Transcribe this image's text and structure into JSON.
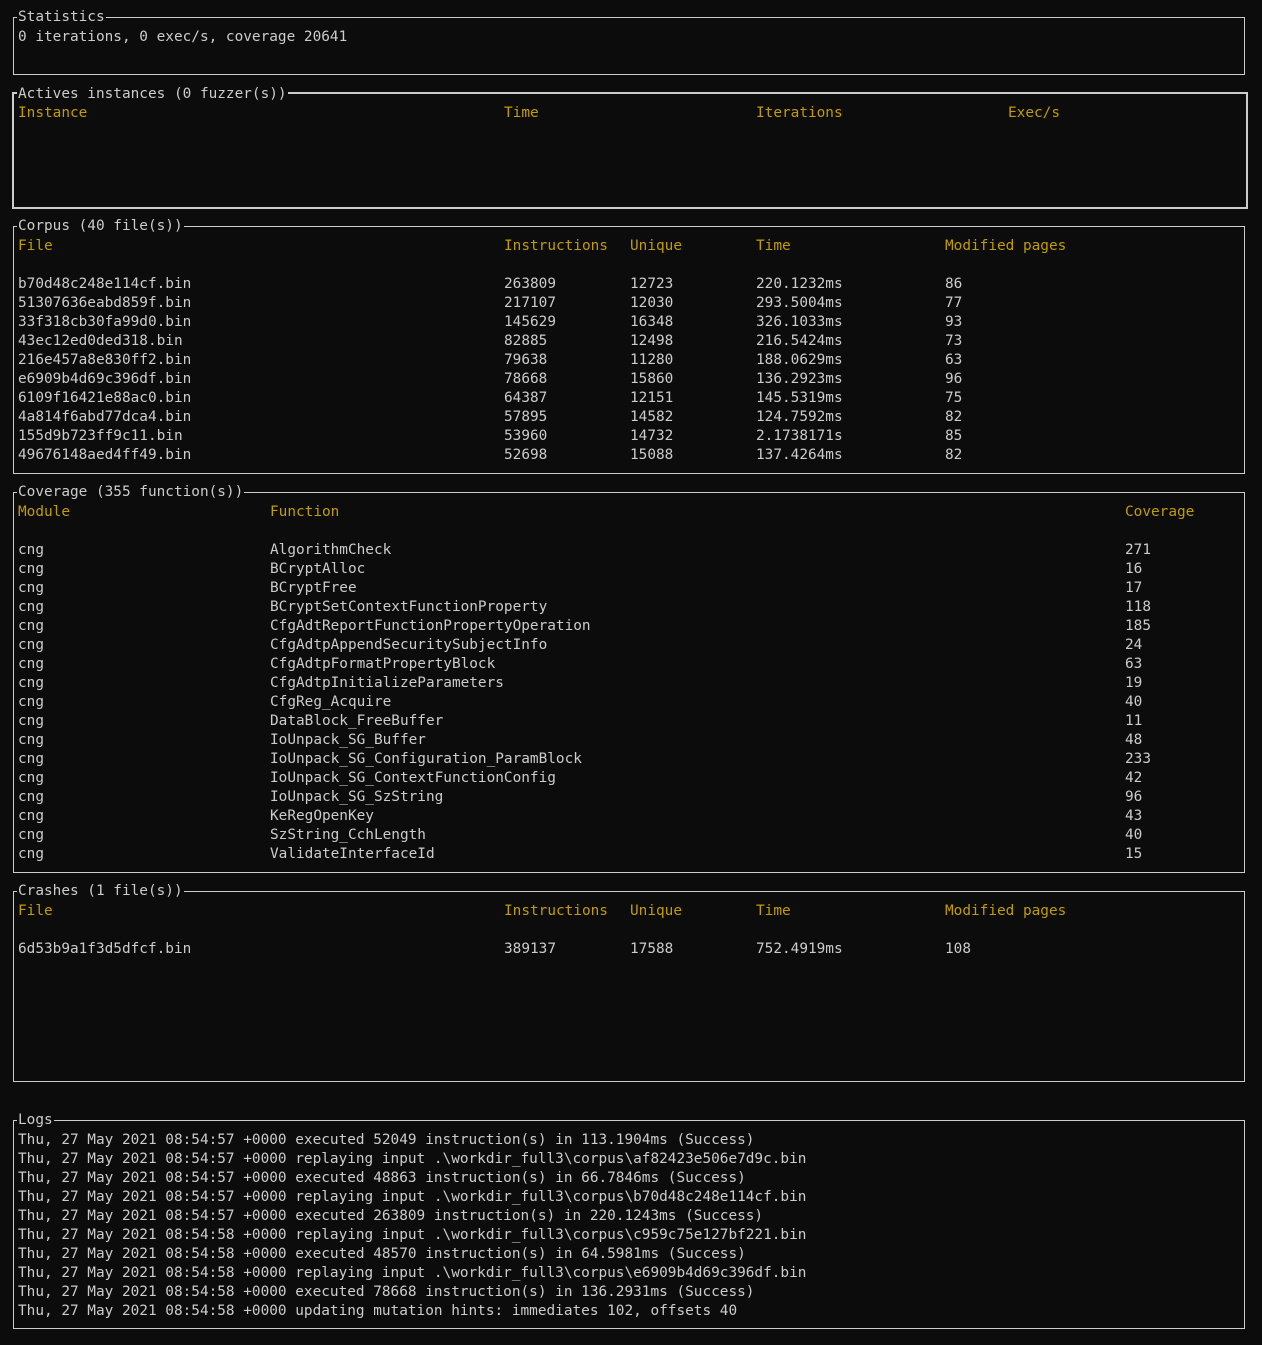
{
  "statistics": {
    "title": "Statistics",
    "text": "0 iterations, 0 exec/s, coverage 20641"
  },
  "actives": {
    "title": "Actives instances (0 fuzzer(s))",
    "headers": [
      "Instance",
      "Time",
      "Iterations",
      "Exec/s"
    ]
  },
  "corpus": {
    "title": "Corpus (40 file(s))",
    "headers": [
      "File",
      "Instructions",
      "Unique",
      "Time",
      "Modified pages"
    ],
    "rows": [
      [
        "b70d48c248e114cf.bin",
        "263809",
        "12723",
        "220.1232ms",
        "86"
      ],
      [
        "51307636eabd859f.bin",
        "217107",
        "12030",
        "293.5004ms",
        "77"
      ],
      [
        "33f318cb30fa99d0.bin",
        "145629",
        "16348",
        "326.1033ms",
        "93"
      ],
      [
        "43ec12ed0ded318.bin",
        "82885",
        "12498",
        "216.5424ms",
        "73"
      ],
      [
        "216e457a8e830ff2.bin",
        "79638",
        "11280",
        "188.0629ms",
        "63"
      ],
      [
        "e6909b4d69c396df.bin",
        "78668",
        "15860",
        "136.2923ms",
        "96"
      ],
      [
        "6109f16421e88ac0.bin",
        "64387",
        "12151",
        "145.5319ms",
        "75"
      ],
      [
        "4a814f6abd77dca4.bin",
        "57895",
        "14582",
        "124.7592ms",
        "82"
      ],
      [
        "155d9b723ff9c11.bin",
        "53960",
        "14732",
        "2.1738171s",
        "85"
      ],
      [
        "49676148aed4ff49.bin",
        "52698",
        "15088",
        "137.4264ms",
        "82"
      ]
    ]
  },
  "coverage": {
    "title": "Coverage (355 function(s))",
    "headers": [
      "Module",
      "Function",
      "Coverage"
    ],
    "rows": [
      [
        "cng",
        "AlgorithmCheck",
        "271"
      ],
      [
        "cng",
        "BCryptAlloc",
        "16"
      ],
      [
        "cng",
        "BCryptFree",
        "17"
      ],
      [
        "cng",
        "BCryptSetContextFunctionProperty",
        "118"
      ],
      [
        "cng",
        "CfgAdtReportFunctionPropertyOperation",
        "185"
      ],
      [
        "cng",
        "CfgAdtpAppendSecuritySubjectInfo",
        "24"
      ],
      [
        "cng",
        "CfgAdtpFormatPropertyBlock",
        "63"
      ],
      [
        "cng",
        "CfgAdtpInitializeParameters",
        "19"
      ],
      [
        "cng",
        "CfgReg_Acquire",
        "40"
      ],
      [
        "cng",
        "DataBlock_FreeBuffer",
        "11"
      ],
      [
        "cng",
        "IoUnpack_SG_Buffer",
        "48"
      ],
      [
        "cng",
        "IoUnpack_SG_Configuration_ParamBlock",
        "233"
      ],
      [
        "cng",
        "IoUnpack_SG_ContextFunctionConfig",
        "42"
      ],
      [
        "cng",
        "IoUnpack_SG_SzString",
        "96"
      ],
      [
        "cng",
        "KeRegOpenKey",
        "43"
      ],
      [
        "cng",
        "SzString_CchLength",
        "40"
      ],
      [
        "cng",
        "ValidateInterfaceId",
        "15"
      ]
    ]
  },
  "crashes": {
    "title": "Crashes (1 file(s))",
    "headers": [
      "File",
      "Instructions",
      "Unique",
      "Time",
      "Modified pages"
    ],
    "rows": [
      [
        "6d53b9a1f3d5dfcf.bin",
        "389137",
        "17588",
        "752.4919ms",
        "108"
      ]
    ]
  },
  "logs": {
    "title": "Logs",
    "lines": [
      "Thu, 27 May 2021 08:54:57 +0000 executed 52049 instruction(s) in 113.1904ms (Success)",
      "Thu, 27 May 2021 08:54:57 +0000 replaying input .\\workdir_full3\\corpus\\af82423e506e7d9c.bin",
      "Thu, 27 May 2021 08:54:57 +0000 executed 48863 instruction(s) in 66.7846ms (Success)",
      "Thu, 27 May 2021 08:54:57 +0000 replaying input .\\workdir_full3\\corpus\\b70d48c248e114cf.bin",
      "Thu, 27 May 2021 08:54:57 +0000 executed 263809 instruction(s) in 220.1243ms (Success)",
      "Thu, 27 May 2021 08:54:58 +0000 replaying input .\\workdir_full3\\corpus\\c959c75e127bf221.bin",
      "Thu, 27 May 2021 08:54:58 +0000 executed 48570 instruction(s) in 64.5981ms (Success)",
      "Thu, 27 May 2021 08:54:58 +0000 replaying input .\\workdir_full3\\corpus\\e6909b4d69c396df.bin",
      "Thu, 27 May 2021 08:54:58 +0000 executed 78668 instruction(s) in 136.2931ms (Success)",
      "Thu, 27 May 2021 08:54:58 +0000 updating mutation hints: immediates 102, offsets 40"
    ]
  }
}
